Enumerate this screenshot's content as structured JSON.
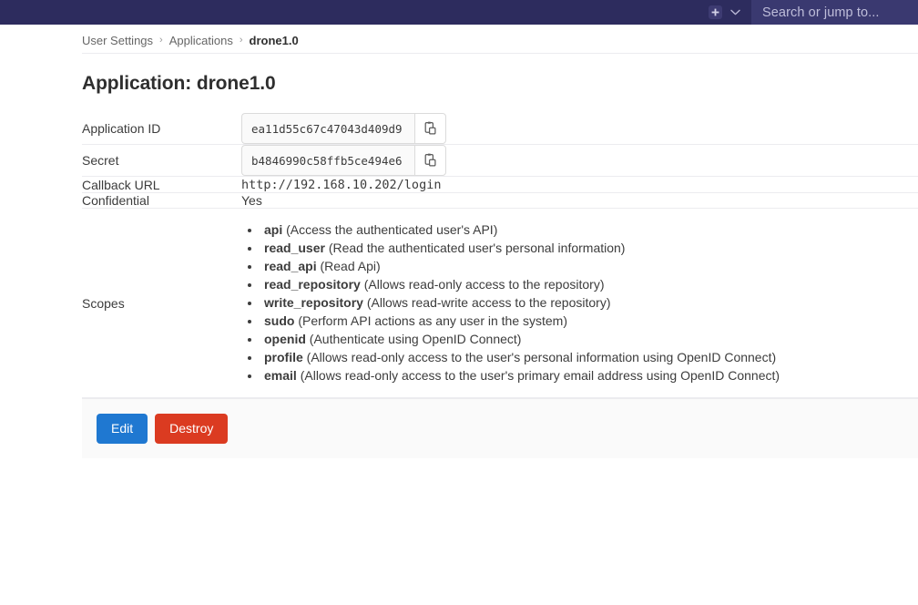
{
  "navbar": {
    "plus_icon": "plus-square-icon",
    "chevron_icon": "chevron-down-icon",
    "search": {
      "placeholder": "Search or jump to...",
      "value": ""
    },
    "background_color": "#2d2c5e",
    "search_background_color": "#3a3970"
  },
  "breadcrumb": {
    "items": [
      {
        "label": "User Settings",
        "current": false
      },
      {
        "label": "Applications",
        "current": false
      },
      {
        "label": "drone1.0",
        "current": true
      }
    ],
    "separator": "›"
  },
  "page": {
    "title": "Application: drone1.0"
  },
  "details": {
    "application_id": {
      "label": "Application ID",
      "value": "ea11d55c67c47043d409d9",
      "copy_icon": "copy-to-clipboard-icon"
    },
    "secret": {
      "label": "Secret",
      "value": "b4846990c58ffb5ce494e6",
      "copy_icon": "copy-to-clipboard-icon"
    },
    "callback_url": {
      "label": "Callback URL",
      "value": "http://192.168.10.202/login"
    },
    "confidential": {
      "label": "Confidential",
      "value": "Yes"
    },
    "scopes": {
      "label": "Scopes",
      "items": [
        {
          "name": "api",
          "description": "(Access the authenticated user's API)"
        },
        {
          "name": "read_user",
          "description": "(Read the authenticated user's personal information)"
        },
        {
          "name": "read_api",
          "description": "(Read Api)"
        },
        {
          "name": "read_repository",
          "description": "(Allows read-only access to the repository)"
        },
        {
          "name": "write_repository",
          "description": "(Allows read-write access to the repository)"
        },
        {
          "name": "sudo",
          "description": "(Perform API actions as any user in the system)"
        },
        {
          "name": "openid",
          "description": "(Authenticate using OpenID Connect)"
        },
        {
          "name": "profile",
          "description": "(Allows read-only access to the user's personal information using OpenID Connect)"
        },
        {
          "name": "email",
          "description": "(Allows read-only access to the user's primary email address using OpenID Connect)"
        }
      ]
    }
  },
  "actions": {
    "edit_label": "Edit",
    "destroy_label": "Destroy",
    "edit_color": "#1f78d1",
    "destroy_color": "#db3b21"
  }
}
